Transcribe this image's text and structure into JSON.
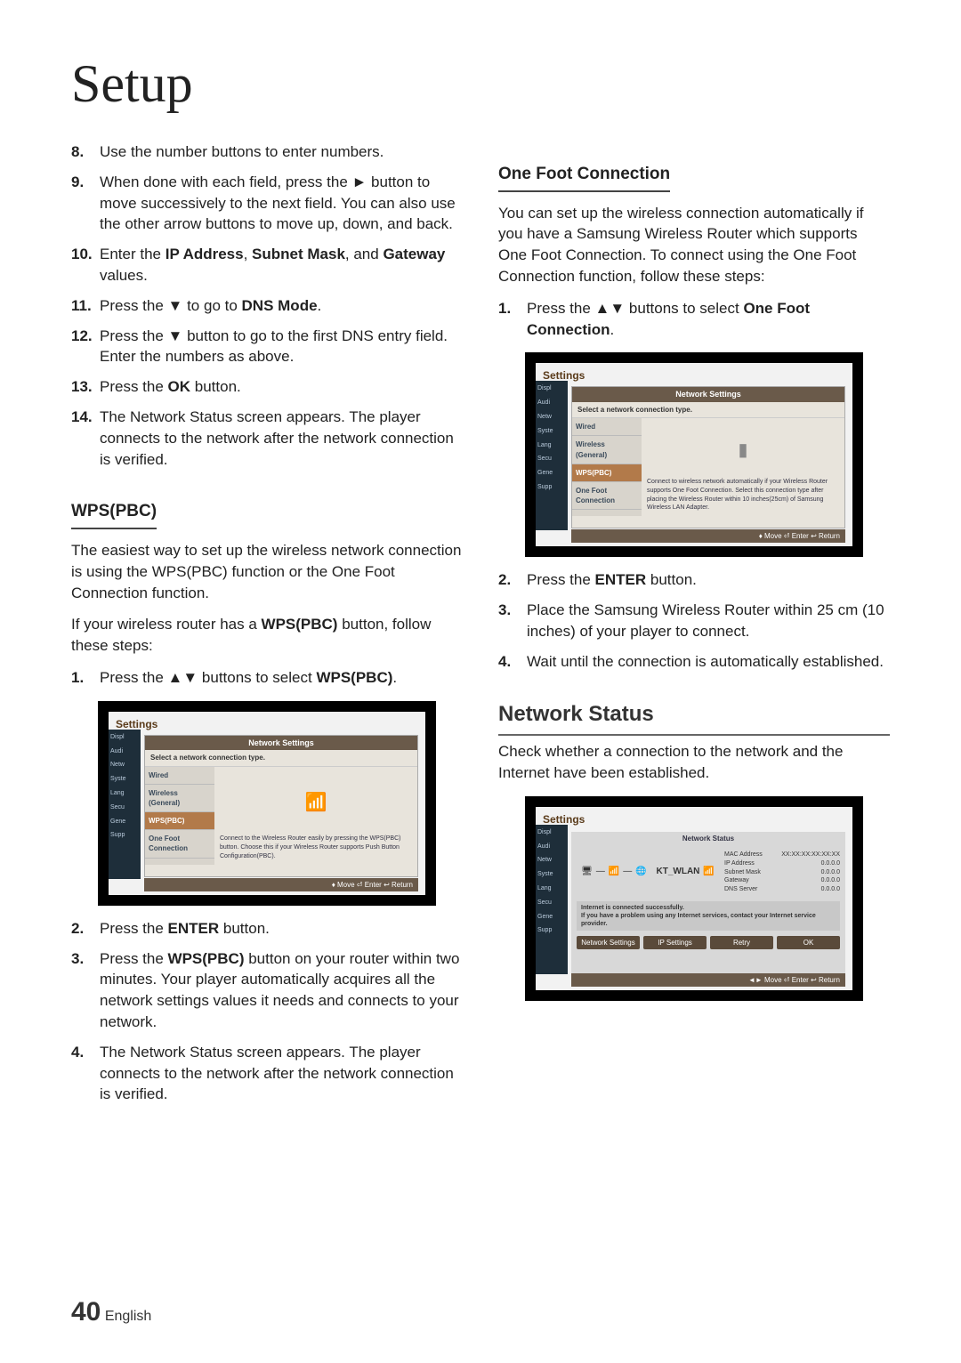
{
  "title": "Setup",
  "footer": {
    "page": "40",
    "lang": "English"
  },
  "col1": {
    "steps_a": [
      {
        "n": "8.",
        "t": "Use the number buttons to enter numbers."
      },
      {
        "n": "9.",
        "t": "When done with each field, press the ► button to move successively to the next field. You can also use the other arrow buttons to move up, down, and back."
      },
      {
        "n": "10.",
        "t": "Enter the IP Address, Subnet Mask, and Gateway values."
      },
      {
        "n": "11.",
        "t": "Press the ▼ to go to DNS Mode."
      },
      {
        "n": "12.",
        "t": "Press the ▼ button to go to the first DNS entry field. Enter the numbers as above."
      },
      {
        "n": "13.",
        "t": "Press the OK button."
      },
      {
        "n": "14.",
        "t": "The Network Status screen appears. The player connects to the network after the network connection is verified."
      }
    ],
    "wps_head": "WPS(PBC)",
    "wps_intro1": "The easiest way to set up the wireless network connection is using the WPS(PBC) function or the One Foot Connection function.",
    "wps_intro2": "If your wireless router has a WPS(PBC) button, follow these steps:",
    "wps_step1": {
      "n": "1.",
      "t": "Press the ▲▼ buttons to select WPS(PBC)."
    },
    "wps_steps_b": [
      {
        "n": "2.",
        "t": "Press the ENTER button."
      },
      {
        "n": "3.",
        "t": "Press the WPS(PBC) button on your router within two minutes. Your player automatically acquires all the network settings values it needs and connects to your network."
      },
      {
        "n": "4.",
        "t": "The Network Status screen appears. The player connects to the network after the network connection is verified."
      }
    ],
    "tv1": {
      "heading": "Settings",
      "side": [
        "Displ",
        "Audi",
        "Netw",
        "Syste",
        "Lang",
        "Secu",
        "Gene",
        "Supp"
      ],
      "dlg_title": "Network Settings",
      "dlg_sub": "Select a network connection type.",
      "list": [
        "Wired",
        "Wireless (General)",
        "WPS(PBC)",
        "One Foot Connection"
      ],
      "selected": "WPS(PBC)",
      "desc": "Connect to the Wireless Router easily by pressing the WPS(PBC) button. Choose this if your Wireless Router supports Push Button Configuration(PBC).",
      "icon": "📶",
      "foot": "♦ Move   ⏎ Enter   ↩ Return"
    }
  },
  "col2": {
    "ofc_head": "One Foot Connection",
    "ofc_intro": "You can set up the wireless connection automatically if you have a Samsung Wireless Router which supports One Foot Connection. To connect using the One Foot Connection function, follow these steps:",
    "ofc_step1": {
      "n": "1.",
      "t": "Press the ▲▼ buttons to select One Foot Connection."
    },
    "tv2": {
      "heading": "Settings",
      "side": [
        "Displ",
        "Audi",
        "Netw",
        "Syste",
        "Lang",
        "Secu",
        "Gene",
        "Supp"
      ],
      "dlg_title": "Network Settings",
      "dlg_sub": "Select a network connection type.",
      "list": [
        "Wired",
        "Wireless (General)",
        "WPS(PBC)",
        "One Foot Connection"
      ],
      "selected": "WPS(PBC)",
      "desc": "Connect to wireless network automatically if your Wireless Router supports One Foot Connection. Select this connection type after placing the Wireless Router within 10 inches(25cm) of Samsung Wireless LAN Adapter.",
      "icon": "▮",
      "foot": "♦ Move   ⏎ Enter   ↩ Return"
    },
    "ofc_steps_b": [
      {
        "n": "2.",
        "t": "Press the ENTER button."
      },
      {
        "n": "3.",
        "t": "Place the Samsung Wireless Router within 25 cm (10 inches) of your player to connect."
      },
      {
        "n": "4.",
        "t": "Wait until the connection is automatically established."
      }
    ],
    "ns_head": "Network Status",
    "ns_intro": "Check whether a connection to the network and the Internet have been established.",
    "tv3": {
      "heading": "Settings",
      "side": [
        "Displ",
        "Audi",
        "Netw",
        "Syste",
        "Lang",
        "Secu",
        "Gene",
        "Supp"
      ],
      "title": "Network Status",
      "wlan": "KT_WLAN",
      "kv": [
        {
          "k": "MAC Address",
          "v": "XX:XX:XX:XX:XX:XX"
        },
        {
          "k": "IP Address",
          "v": "0.0.0.0"
        },
        {
          "k": "Subnet Mask",
          "v": "0.0.0.0"
        },
        {
          "k": "Gateway",
          "v": "0.0.0.0"
        },
        {
          "k": "DNS Server",
          "v": "0.0.0.0"
        }
      ],
      "msg1": "Internet is connected successfully.",
      "msg2": "If you have a problem using any Internet services, contact your Internet service provider.",
      "btns": [
        "Network Settings",
        "IP Settings",
        "Retry",
        "OK"
      ],
      "foot": "◄► Move   ⏎ Enter   ↩ Return"
    }
  }
}
